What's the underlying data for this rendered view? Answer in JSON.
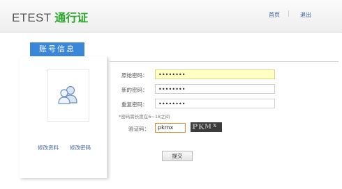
{
  "header": {
    "brand_en": "ETEST",
    "brand_cn": "通行证",
    "nav": {
      "home": "首页",
      "separator": "|",
      "logout": "退出"
    }
  },
  "left": {
    "tab_label": "账号信息",
    "avatar_icon": "users-icon",
    "links": {
      "profile": "修改资料",
      "password": "修改密码"
    }
  },
  "form": {
    "old_label": "原始密码：",
    "old_value": "••••••••",
    "new_label": "新的密码：",
    "new_value": "••••••••",
    "repeat_label": "重复密码：",
    "repeat_value": "••••••••",
    "hint": "*密码需长度在6~18之间",
    "captcha_label": "验证码：",
    "captcha_value": "pkmx",
    "submit_label": "提交"
  },
  "colors": {
    "brand_green": "#2aa52a",
    "tab_blue": "#3a86d8",
    "link_blue": "#3a5f9e",
    "highlight": "#ffffc3"
  }
}
